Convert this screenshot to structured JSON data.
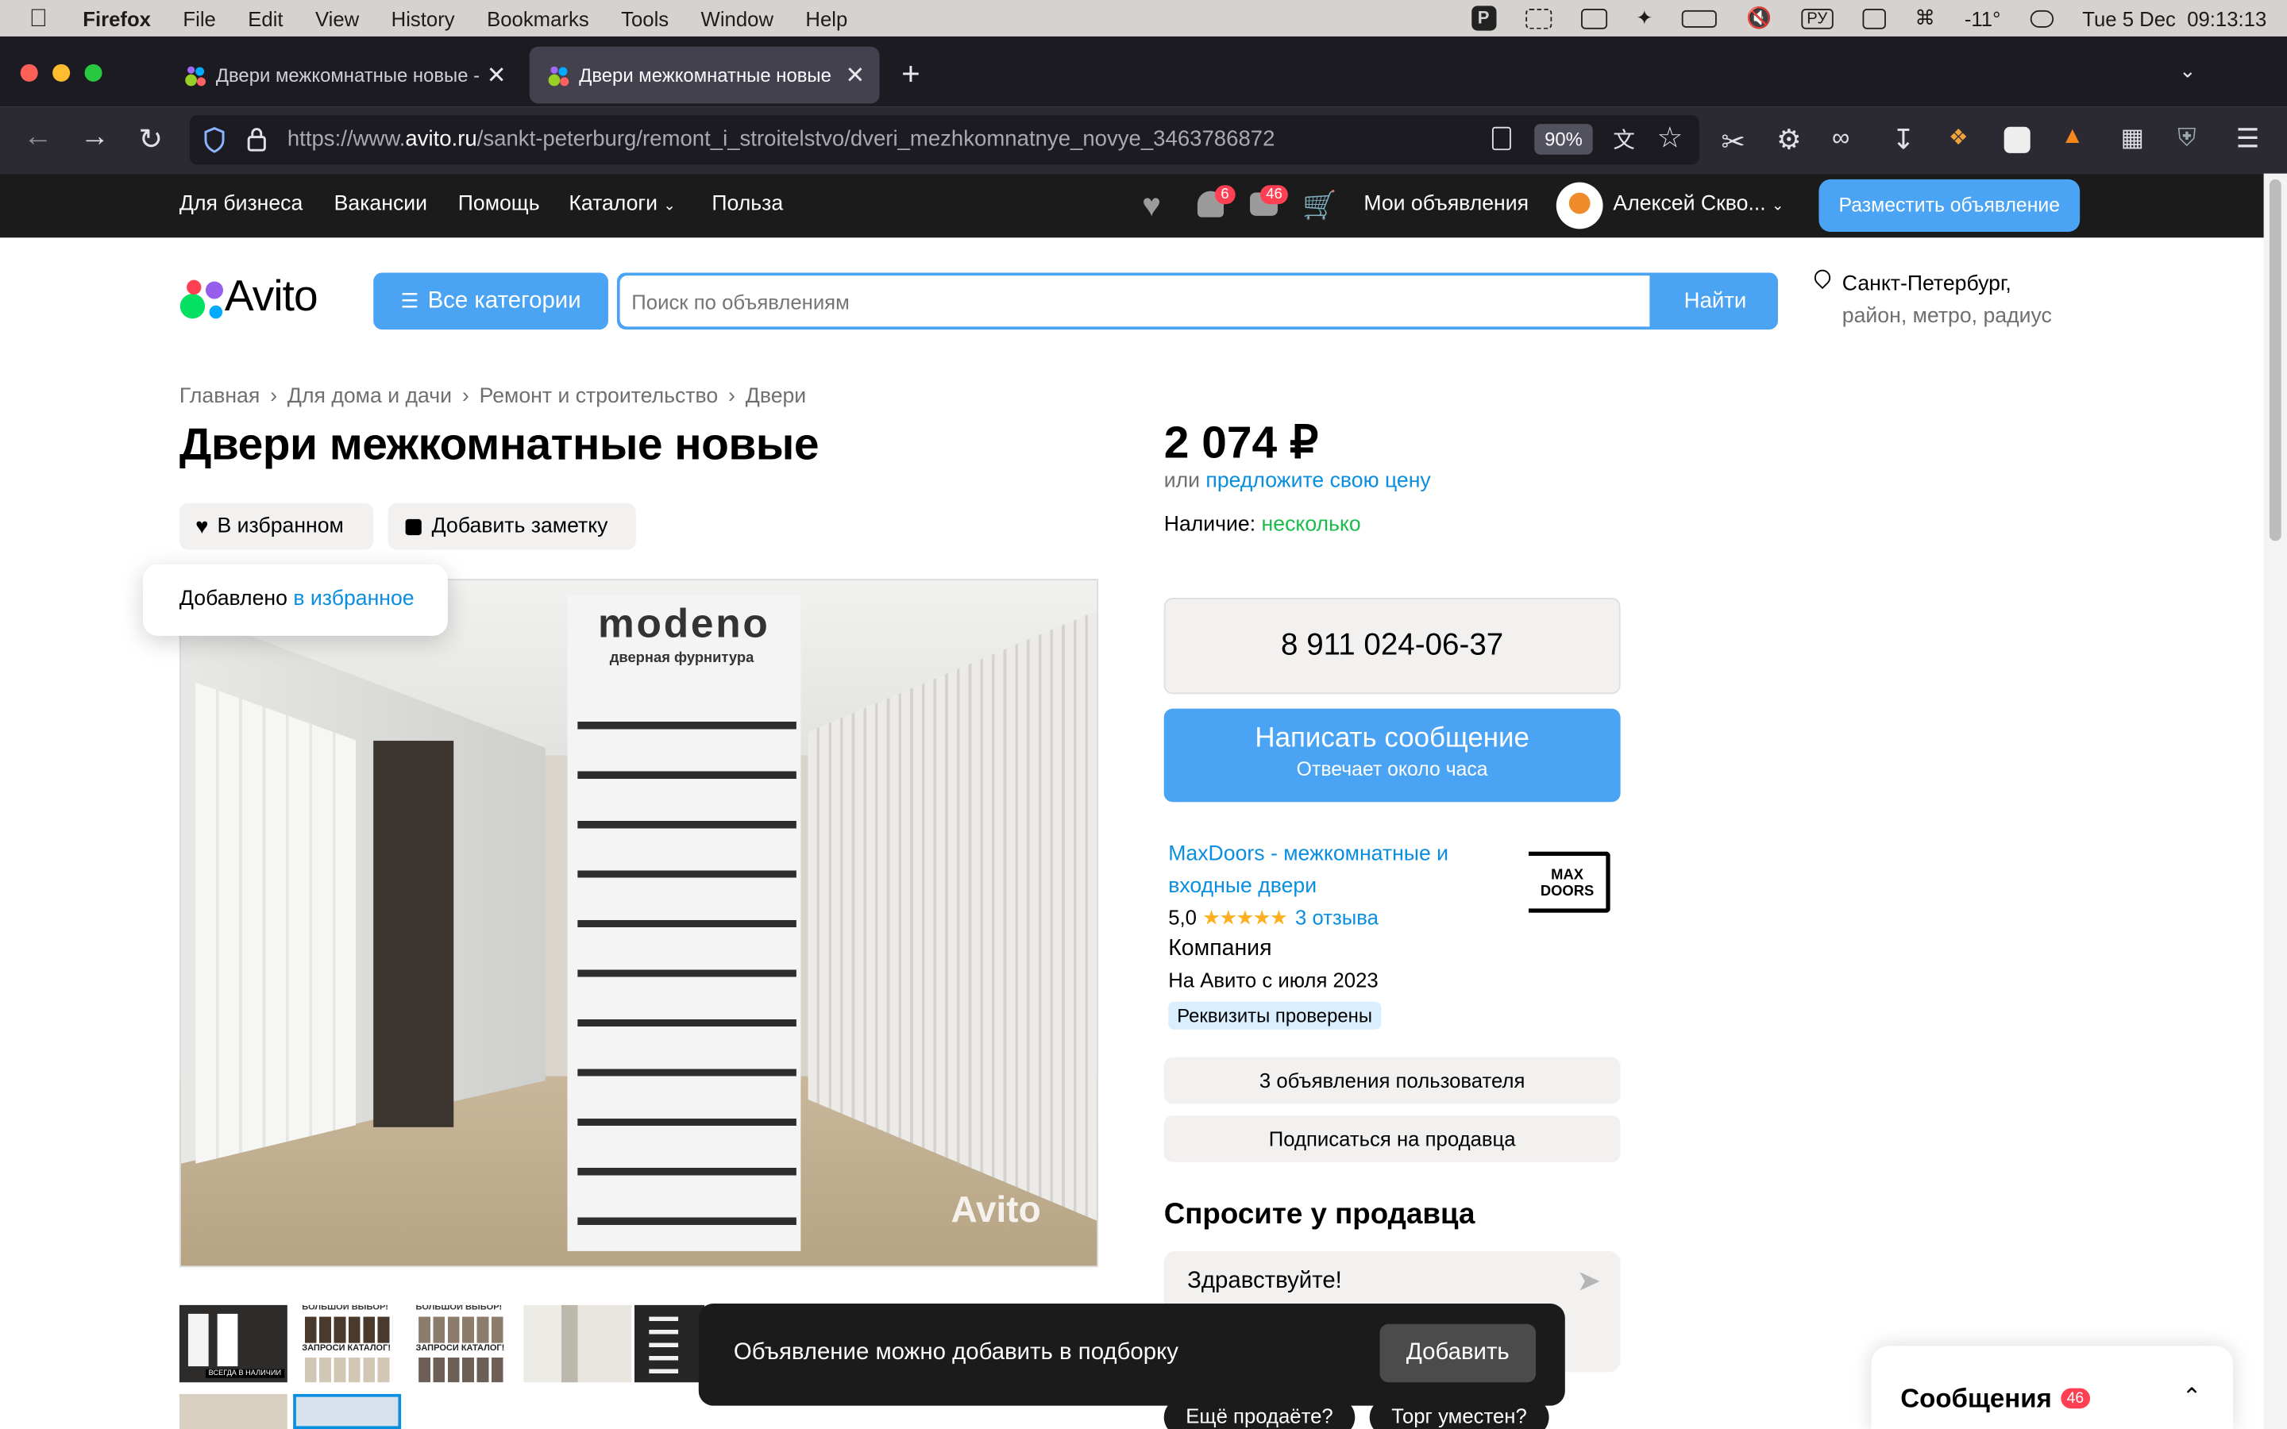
{
  "menubar": {
    "app": "Firefox",
    "items": [
      "File",
      "Edit",
      "View",
      "History",
      "Bookmarks",
      "Tools",
      "Window",
      "Help"
    ],
    "keyboard_layout": "РУ",
    "temperature": "-11°",
    "datetime": "Tue 5 Dec  09:13:13"
  },
  "browser": {
    "tabs": [
      {
        "title": "Двери межкомнатные новые -"
      },
      {
        "title": "Двери межкомнатные новые к"
      }
    ],
    "url_host_prefix": "https://www.",
    "url_host": "avito.ru",
    "url_path": "/sankt-peterburg/remont_i_stroitelstvo/dveri_mezhkomnatnye_novye_3463786872",
    "zoom": "90%"
  },
  "site_header": {
    "links": [
      "Для бизнеса",
      "Вакансии",
      "Помощь",
      "Каталоги",
      "Польза"
    ],
    "notifications_count": "6",
    "messages_count": "46",
    "my_ads": "Мои объявления",
    "user_name": "Алексей Скво...",
    "post_ad": "Разместить объявление"
  },
  "search": {
    "logo_text": "Avito",
    "categories_button": "Все категории",
    "placeholder": "Поиск по объявлениям",
    "find_button": "Найти",
    "location_city": "Санкт-Петербург,",
    "location_detail": "район, метро, радиус"
  },
  "breadcrumbs": [
    "Главная",
    "Для дома и дачи",
    "Ремонт и строительство",
    "Двери"
  ],
  "listing": {
    "title": "Двери межкомнатные новые",
    "favorite_button": "В избранном",
    "note_button": "Добавить заметку",
    "tooltip_prefix": "Добавлено ",
    "tooltip_link": "в избранное",
    "photo_brand": "modeno",
    "photo_brand_sub": "дверная фурнитура",
    "photo_watermark": "Avito",
    "thumb_captions": [
      "ВСЕГДА В НАЛИЧИИ",
      "ЗАПРОСИ КАТАЛОГ!",
      "ЗАПРОСИ КАТАЛОГ!"
    ],
    "thumb_headers": [
      "БОЛЬШОЙ ВЫБОР!",
      "БОЛЬШОЙ ВЫБОР!"
    ]
  },
  "price": {
    "amount": "2 074 ₽",
    "or": "или ",
    "offer_link": "предложите свою цену",
    "availability_label": "Наличие: ",
    "availability_value": "несколько"
  },
  "seller": {
    "phone": "8 911 024-06-37",
    "message_button": "Написать сообщение",
    "message_sub": "Отвечает около часа",
    "name_line1": "MaxDoors - межкомнатные и",
    "name_line2": "входные двери",
    "rating": "5,0",
    "rating_value": 5,
    "reviews": "3 отзыва",
    "type": "Компания",
    "since": "На Авито с июля 2023",
    "verified": "Реквизиты проверены",
    "logo_line1": "MAX",
    "logo_line2": "DOORS",
    "ads_button": "3 объявления пользователя",
    "subscribe_button": "Подписаться на продавца"
  },
  "ask": {
    "title": "Спросите у продавца",
    "input_value": "Здравствуйте!",
    "chips": [
      "Ещё продаёте?",
      "Торг уместен?"
    ]
  },
  "toast": {
    "text": "Объявление можно добавить в подборку",
    "button": "Добавить"
  },
  "messenger": {
    "title": "Сообщения",
    "count": "46"
  },
  "colors": {
    "accent": "#00aaff",
    "button_blue": "#4aa3f3",
    "link": "#0a8ee0",
    "green": "#1cbc4c"
  }
}
